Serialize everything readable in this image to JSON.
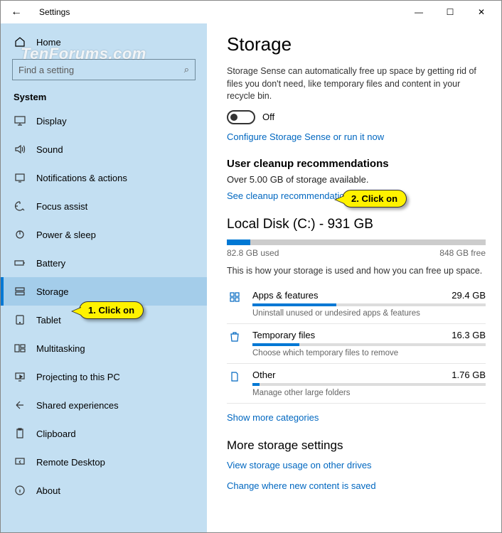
{
  "window": {
    "title": "Settings",
    "min": "—",
    "max": "☐",
    "close": "✕",
    "back": "←"
  },
  "watermark": "TenForums.com",
  "sidebar": {
    "home": "Home",
    "search_placeholder": "Find a setting",
    "search_icon": "⌕",
    "section": "System",
    "items": [
      {
        "label": "Display",
        "icon": "display"
      },
      {
        "label": "Sound",
        "icon": "sound"
      },
      {
        "label": "Notifications & actions",
        "icon": "notifications"
      },
      {
        "label": "Focus assist",
        "icon": "focus"
      },
      {
        "label": "Power & sleep",
        "icon": "power"
      },
      {
        "label": "Battery",
        "icon": "battery"
      },
      {
        "label": "Storage",
        "icon": "storage",
        "selected": true
      },
      {
        "label": "Tablet",
        "icon": "tablet"
      },
      {
        "label": "Multitasking",
        "icon": "multitask"
      },
      {
        "label": "Projecting to this PC",
        "icon": "project"
      },
      {
        "label": "Shared experiences",
        "icon": "shared"
      },
      {
        "label": "Clipboard",
        "icon": "clipboard"
      },
      {
        "label": "Remote Desktop",
        "icon": "remote"
      },
      {
        "label": "About",
        "icon": "about"
      }
    ]
  },
  "main": {
    "title": "Storage",
    "sense_desc": "Storage Sense can automatically free up space by getting rid of files you don't need, like temporary files and content in your recycle bin.",
    "toggle_label": "Off",
    "configure_link": "Configure Storage Sense or run it now",
    "cleanup": {
      "heading": "User cleanup recommendations",
      "sub": "Over 5.00 GB of storage available.",
      "link": "See cleanup recommendations"
    },
    "disk": {
      "name": "Local Disk (C:) - 931 GB",
      "used": "82.8 GB used",
      "free": "848 GB free",
      "desc": "This is how your storage is used and how you can free up space."
    },
    "categories": [
      {
        "name": "Apps & features",
        "size": "29.4 GB",
        "sub": "Uninstall unused or undesired apps & features",
        "pct": 36
      },
      {
        "name": "Temporary files",
        "size": "16.3 GB",
        "sub": "Choose which temporary files to remove",
        "pct": 20
      },
      {
        "name": "Other",
        "size": "1.76 GB",
        "sub": "Manage other large folders",
        "pct": 3
      }
    ],
    "show_more": "Show more categories",
    "more_heading": "More storage settings",
    "link_other_drives": "View storage usage on other drives",
    "link_change_save": "Change where new content is saved"
  },
  "callouts": {
    "c1": "1. Click on",
    "c2": "2. Click on"
  }
}
